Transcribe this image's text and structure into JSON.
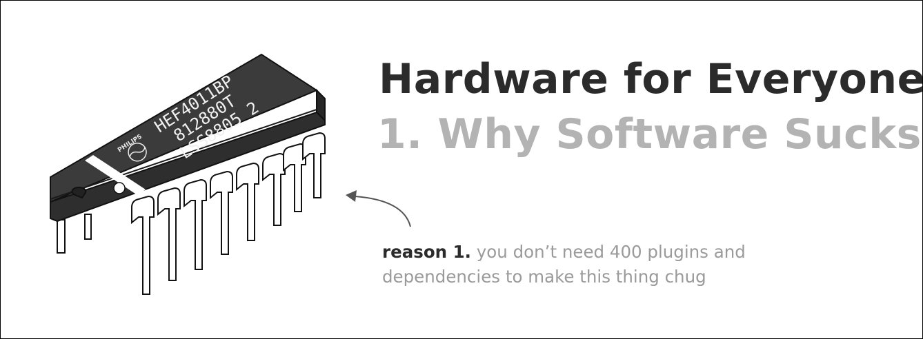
{
  "heading": {
    "title": "Hardware for Everyone:",
    "subtitle_number": "1.",
    "subtitle_text": "Why Software Sucks"
  },
  "caption": {
    "lead": "reason 1.",
    "line1": "you don’t need 400 plugins and",
    "line2": "dependencies to make this thing chug"
  },
  "chip": {
    "brand": "PHILIPS",
    "marking_line1": "HEF4011BP",
    "marking_line2": "812880T",
    "marking_line3": "LSS8805  2"
  },
  "colors": {
    "title": "#2b2b2b",
    "subtitle": "#b3b3b3",
    "caption_lead": "#2b2b2b",
    "caption_text": "#9a9a9a",
    "chip_body": "#3a3a3a"
  }
}
